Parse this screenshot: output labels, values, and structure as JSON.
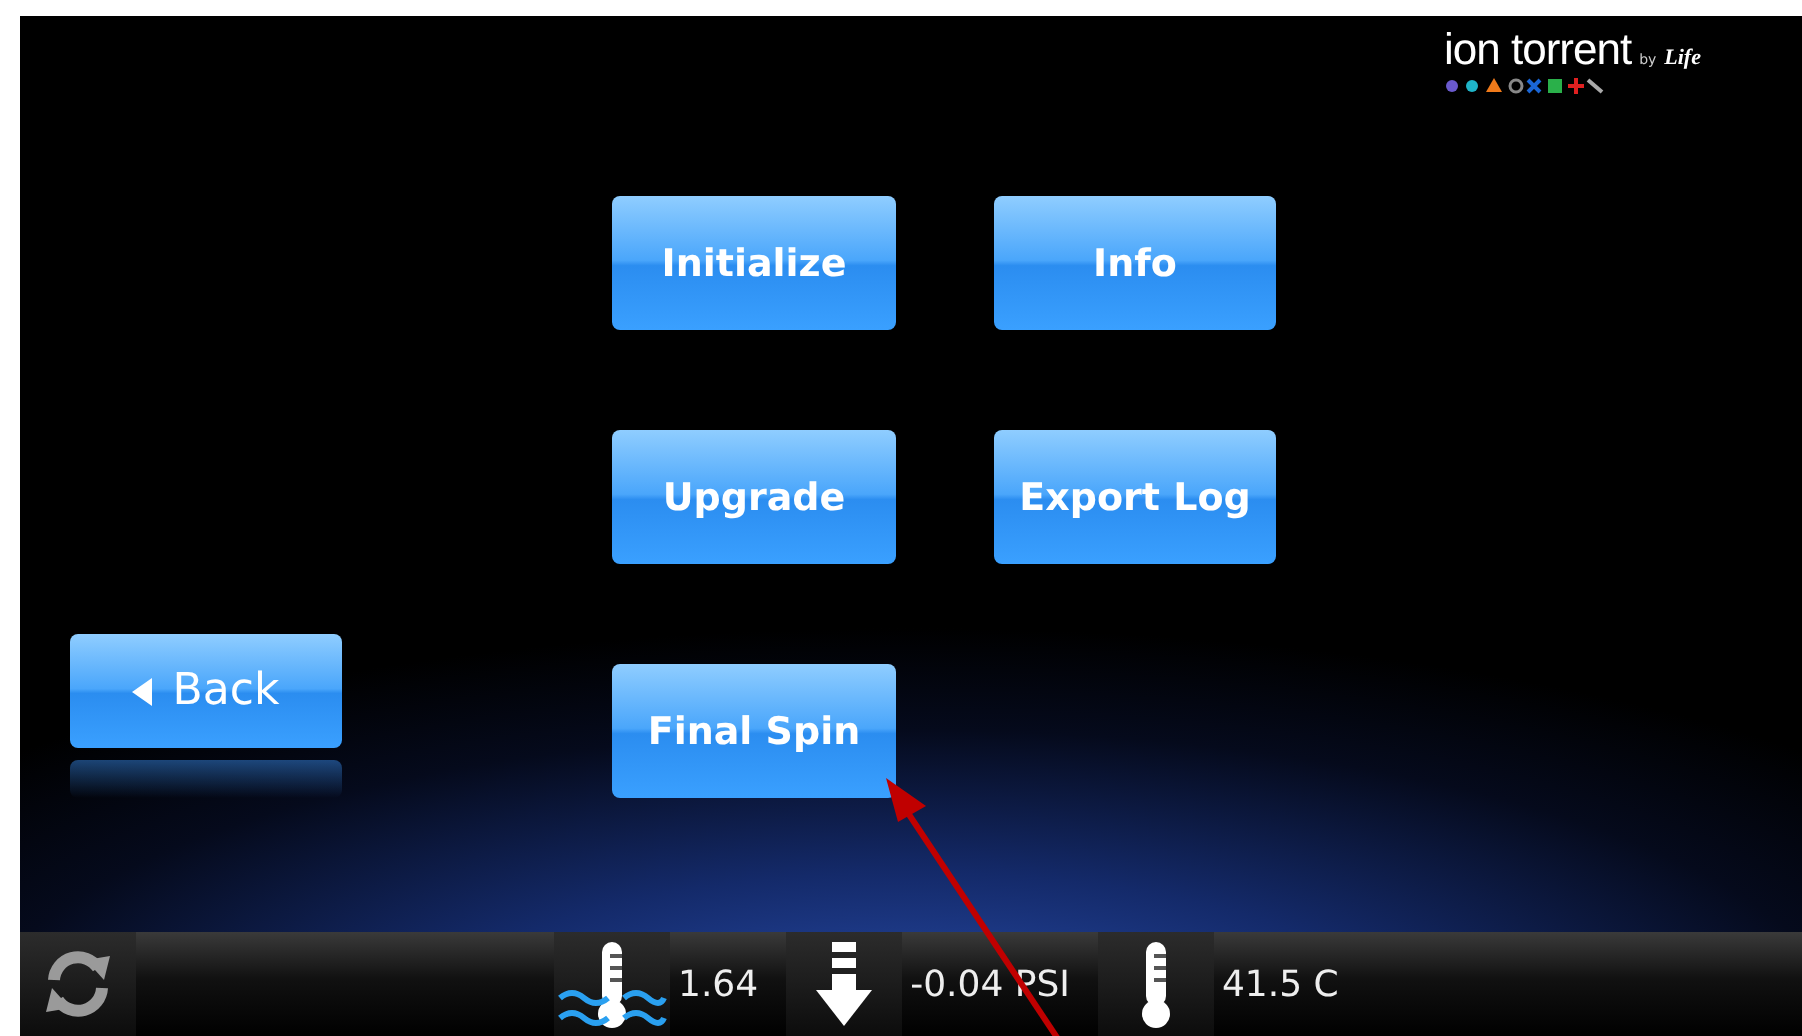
{
  "logo": {
    "brand": "ion torrent",
    "by": "by",
    "maker": "Life"
  },
  "menu_buttons": [
    {
      "label": "Initialize"
    },
    {
      "label": "Info"
    },
    {
      "label": "Upgrade"
    },
    {
      "label": "Export Log"
    },
    {
      "label": "Final Spin"
    }
  ],
  "back_button": {
    "label": "Back"
  },
  "status_bar": {
    "readings": [
      {
        "kind": "temperature-flow",
        "value": "1.64"
      },
      {
        "kind": "pressure",
        "value": "-0.04 PSI"
      },
      {
        "kind": "temperature",
        "value": "41.5 C"
      }
    ]
  }
}
